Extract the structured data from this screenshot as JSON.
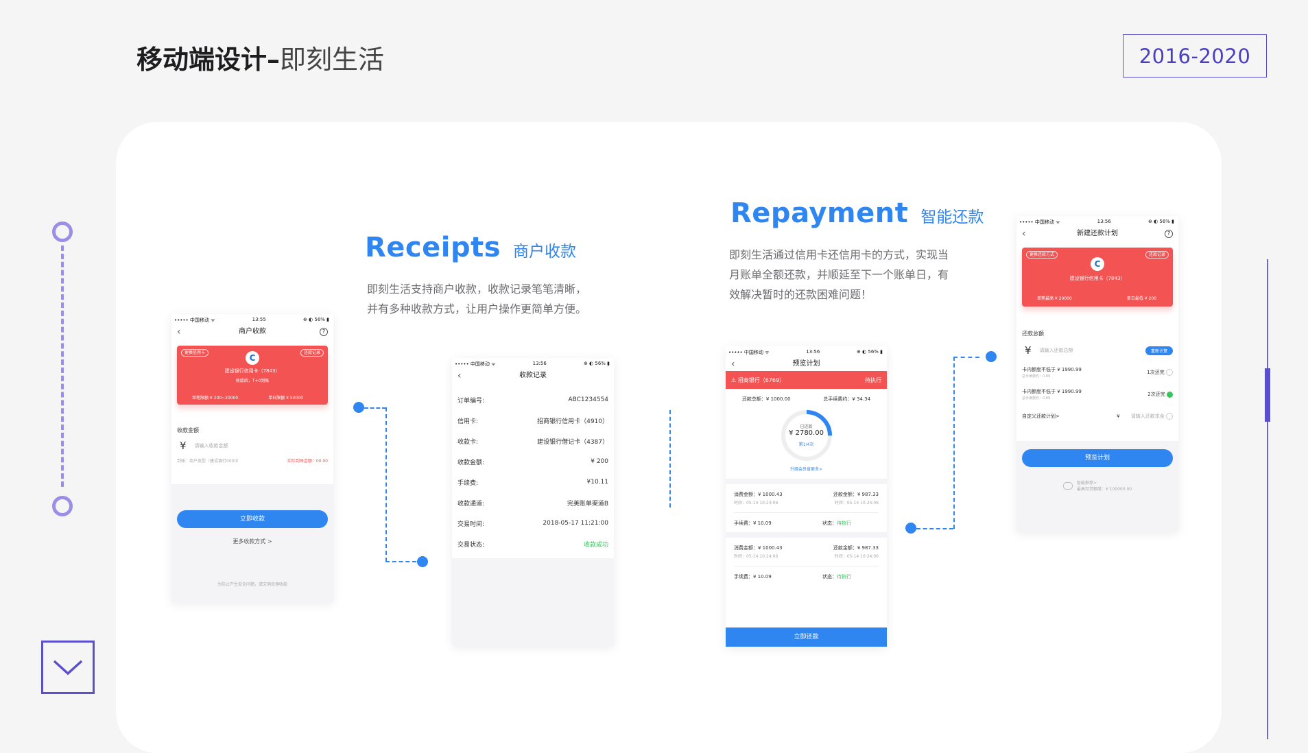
{
  "header": {
    "title_bold": "移动端设计",
    "separator": "–",
    "title_light": "即刻生活",
    "years": "2016-2020"
  },
  "colors": {
    "accent_purple": "#5a4ec8",
    "blue": "#2f86f0",
    "red": "#f35353",
    "green": "#38c35c"
  },
  "receipts": {
    "title_en": "Receipts",
    "title_cn": "商户收款",
    "desc_line1": "即刻生活支持商户收款，收款记录笔笔清晰，",
    "desc_line2": "并有多种收款方式，让用户操作更简单方便。"
  },
  "repayment": {
    "title_en": "Repayment",
    "title_cn": "智能还款",
    "desc_line1": "即刻生活通过信用卡还信用卡的方式，实现当",
    "desc_line2": "月账单全额还款，并顺延至下一个账单日，有",
    "desc_line3": "效解决暂时的还款困难问题！"
  },
  "phone1": {
    "carrier": "••••• 中国移动 ᯤ",
    "time": "13:55",
    "battery": "⊕ ◐ 56% ▮",
    "nav_title": "商户收款",
    "pill_left": "更换信用卡",
    "pill_right": "还款记录",
    "card_name": "建设银行信用卡（7843）",
    "card_sub": "收款后，T+0到账",
    "limit_left": "单笔限额 ¥ 200~20000",
    "limit_right": "单日限额 ¥ 50000",
    "amount_label": "收款金额",
    "currency": "¥",
    "amount_placeholder": "请输入收款金额",
    "fee_note": "到账：商户类型（建设银行0000）",
    "actual_amount": "实际到账金额：00.00",
    "primary_button": "立即收款",
    "more_link": "更多收款方式 >",
    "footer_note": "为防止产生安全问题，请文明合理收款"
  },
  "phone2": {
    "carrier": "••••• 中国移动 ᯤ",
    "time": "13:56",
    "battery": "⊕ ◐ 56% ▮",
    "nav_title": "收款记录",
    "rows": [
      {
        "label": "订单编号:",
        "value": "ABC1234554"
      },
      {
        "label": "信用卡:",
        "value": "招商银行信用卡（4910）"
      },
      {
        "label": "收款卡:",
        "value": "建设银行借记卡（4387）"
      },
      {
        "label": "收款金额:",
        "value": "¥ 200"
      },
      {
        "label": "手续费:",
        "value": "¥10.11"
      },
      {
        "label": "收款通道:",
        "value": "完美账单渠道B"
      },
      {
        "label": "交易时间:",
        "value": "2018-05-17   11:21:00"
      },
      {
        "label": "交易状态:",
        "value": "收款成功"
      }
    ]
  },
  "phone3": {
    "carrier": "••••• 中国移动 ᯤ",
    "time": "13:56",
    "battery": "⊕ ◐ 56% ▮",
    "nav_title": "预览计划",
    "bank": "招商银行（6769）",
    "bank_status": "待执行",
    "total_label": "还款总额：¥ 1000.00",
    "fee_total": "总手续费约：¥ 34.34",
    "ring_label": "已还款",
    "ring_value": "¥ 2780.00",
    "ring_progress": "第1/4次",
    "ring_fraction": 0.25,
    "link": "升级会员省更多>",
    "records": [
      {
        "spend": "消费金额：¥ 1000.43",
        "spend_time": "时间：05-14  10:24:06",
        "repay": "还款金额：¥ 987.33",
        "repay_time": "时间：05-14  10:24:06",
        "fee": "手续费：¥ 10.09",
        "status_label": "状态：",
        "status": "待执行"
      },
      {
        "spend": "消费金额：¥ 1000.43",
        "spend_time": "时间：05-14  10:24:06",
        "repay": "还款金额：¥ 987.33",
        "repay_time": "时间：05-14  10:24:06",
        "fee": "手续费：¥ 10.09",
        "status_label": "状态：",
        "status": "待执行"
      }
    ],
    "primary_button": "立即还款"
  },
  "phone4": {
    "carrier": "••••• 中国移动 ᯤ",
    "time": "13:56",
    "battery": "⊕ ◐ 56% ▮",
    "nav_title": "新建还款计划",
    "pill_left": "更换还款方式",
    "pill_right": "还款记录",
    "card_name": "建设银行信用卡（7843）",
    "limit_left": "单笔最高 ¥ 20000",
    "limit_right": "单日最低 ¥ 200",
    "amount_label": "还款总额",
    "currency": "¥",
    "amount_placeholder": "请输入还款总额",
    "recalc_button": "重新计算",
    "option1": "卡内额度不低于 ¥ 1990.99",
    "option1_sub": "总手续费约：0.89",
    "option1_right": "1次还完",
    "option2": "卡内额度不低于 ¥ 1990.99",
    "option2_sub": "总手续费约：0.89",
    "option2_right": "2次还完",
    "custom_label": "自定义还款计划>",
    "custom_currency": "¥",
    "custom_placeholder": "请输入还款本金",
    "primary_button": "预览计划",
    "footer_line1": "智能推荐>",
    "footer_line2": "最高可贷额度：¥ 100000.00"
  }
}
